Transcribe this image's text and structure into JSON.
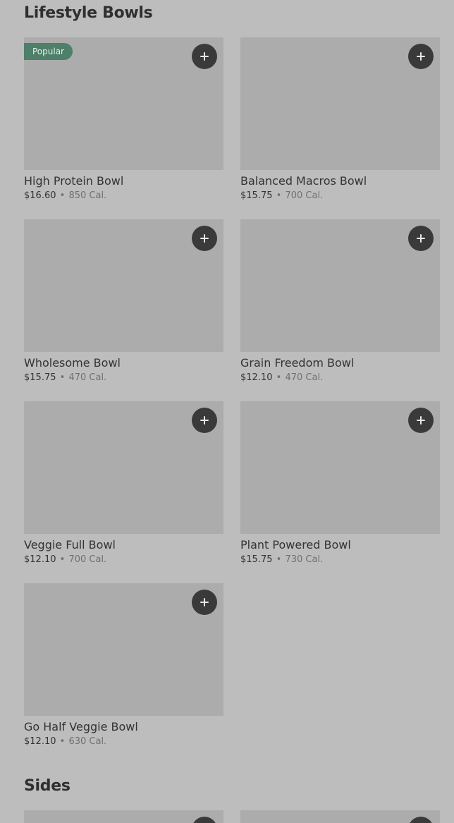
{
  "sections": [
    {
      "title": "Lifestyle Bowls",
      "items": [
        {
          "name": "High Protein Bowl",
          "price": "$16.60",
          "separator": "•",
          "calories": "850 Cal.",
          "badge": "Popular"
        },
        {
          "name": "Balanced Macros Bowl",
          "price": "$15.75",
          "separator": "•",
          "calories": "700 Cal."
        },
        {
          "name": "Wholesome Bowl",
          "price": "$15.75",
          "separator": "•",
          "calories": "470 Cal."
        },
        {
          "name": "Grain Freedom Bowl",
          "price": "$12.10",
          "separator": "•",
          "calories": "470 Cal."
        },
        {
          "name": "Veggie Full Bowl",
          "price": "$12.10",
          "separator": "•",
          "calories": "700 Cal."
        },
        {
          "name": "Plant Powered Bowl",
          "price": "$15.75",
          "separator": "•",
          "calories": "730 Cal."
        },
        {
          "name": "Go Half Veggie Bowl",
          "price": "$12.10",
          "separator": "•",
          "calories": "630 Cal."
        }
      ]
    },
    {
      "title": "Sides"
    }
  ],
  "icons": {
    "add": "plus-icon"
  },
  "colors": {
    "background": "#bdbdbd",
    "placeholder": "#acacac",
    "badge": "#4d7f69",
    "add_button": "#3a3a3a"
  }
}
